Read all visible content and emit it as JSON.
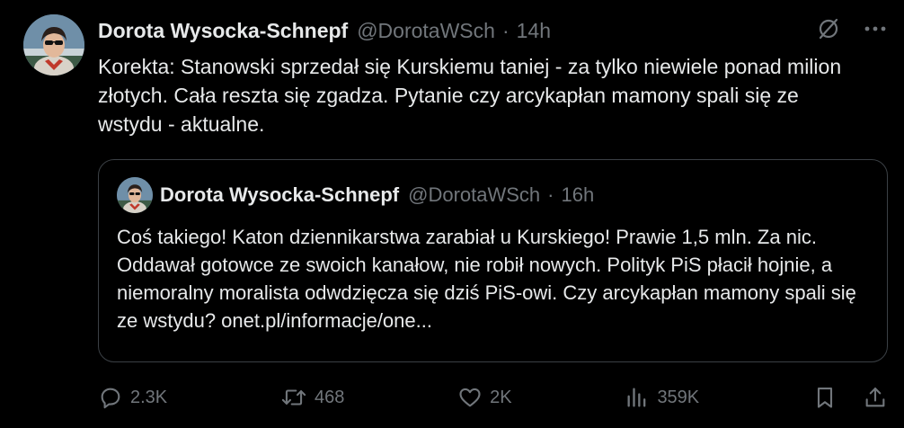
{
  "tweet": {
    "author_name": "Dorota Wysocka-Schnepf",
    "handle": "@DorotaWSch",
    "separator": "·",
    "time": "14h",
    "text": "Korekta: Stanowski sprzedał się Kurskiemu taniej - za tylko niewiele ponad milion złotych. Cała reszta się zgadza. Pytanie czy arcykapłan mamony spali się ze wstydu - aktualne."
  },
  "quoted": {
    "author_name": "Dorota Wysocka-Schnepf",
    "handle": "@DorotaWSch",
    "separator": "·",
    "time": "16h",
    "text": "Coś takiego! Katon dziennikarstwa zarabiał u Kurskiego! Prawie 1,5 mln. Za nic. Oddawał gotowce ze swoich kanałow, nie robił nowych. Polityk PiS płacił hojnie, a niemoralny moralista odwdzięcza się dziś PiS-owi. Czy arcykapłan mamony spali się ze wstydu? onet.pl/informacje/one..."
  },
  "actions": {
    "replies": "2.3K",
    "reposts": "468",
    "likes": "2K",
    "views": "359K"
  },
  "icons": {
    "grok": "slashed-circle-icon",
    "more": "more-dots-icon",
    "reply": "reply-icon",
    "repost": "repost-icon",
    "like": "heart-icon",
    "views": "views-icon",
    "bookmark": "bookmark-icon",
    "share": "share-icon"
  },
  "colors": {
    "background": "#000000",
    "text_primary": "#e7e9ea",
    "text_secondary": "#71767b",
    "border": "#3b4045"
  }
}
